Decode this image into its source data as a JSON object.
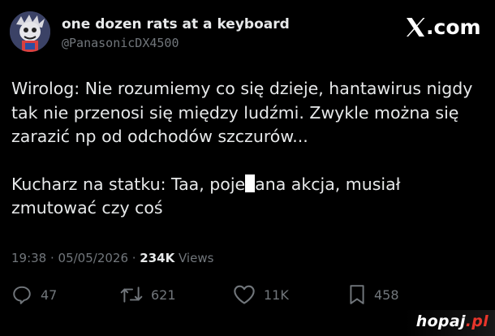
{
  "header": {
    "display_name": "one dozen rats at a keyboard",
    "handle": "@PanasonicDX4500",
    "brand": ".com"
  },
  "tweet": {
    "paragraph1": "Wirolog: Nie rozumiemy co się dzieje, hantawirus nigdy tak nie przenosi się między ludźmi. Zwykle można się zarazić np od odchodów szczurów...",
    "paragraph2_before": "Kucharz na statku: Taa, poje",
    "paragraph2_after": "ana akcja, musiał zmutować czy coś"
  },
  "meta": {
    "timestamp": "19:38 · 05/05/2026 · ",
    "views_count": "234K",
    "views_label": " Views"
  },
  "actions": {
    "replies": "47",
    "reposts": "621",
    "likes": "11K",
    "bookmarks": "458"
  },
  "watermark": {
    "name": "hopaj",
    "tld": ".pl"
  },
  "icons": {
    "brand": "x-logo-icon",
    "reply": "reply-icon",
    "repost": "repost-icon",
    "like": "heart-icon",
    "bookmark": "bookmark-icon"
  }
}
